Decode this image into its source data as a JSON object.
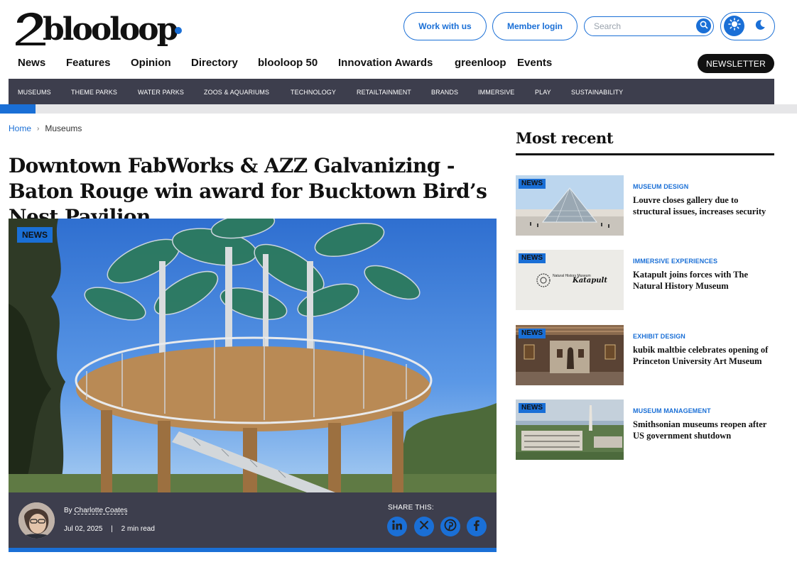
{
  "brand": {
    "logo_text": "2blooloop.",
    "accent": "#1a6fd6",
    "dark_bar": "#3d3e4d"
  },
  "header": {
    "work_with_us": "Work with us",
    "member_login": "Member login",
    "search_placeholder": "Search",
    "icons": {
      "search": "search-icon",
      "light_mode": "sun-icon",
      "dark_mode": "moon-icon"
    }
  },
  "main_nav": [
    "News",
    "Features",
    "Opinion",
    "Directory",
    "blooloop 50",
    "Innovation Awards",
    "greenloop",
    "Events"
  ],
  "newsletter_label": "NEWSLETTER",
  "sub_nav": [
    "MUSEUMS",
    "THEME PARKS",
    "WATER PARKS",
    "ZOOS & AQUARIUMS",
    "TECHNOLOGY",
    "RETAILTAINMENT",
    "BRANDS",
    "IMMERSIVE",
    "PLAY",
    "SUSTAINABILITY"
  ],
  "reading_progress_percent": 4.5,
  "breadcrumb": {
    "home": "Home",
    "current": "Museums"
  },
  "article": {
    "title": "Downtown FabWorks & AZZ Galvanizing - Baton Rouge win award for Bucktown Bird’s Nest Pavilion",
    "tag": "NEWS",
    "by_prefix": "By",
    "author": "Charlotte Coates",
    "date": "Jul 02, 2025",
    "read_time": "2 min read",
    "share_label": "SHARE THIS:",
    "share_icons": [
      "linkedin-icon",
      "x-icon",
      "pinterest-icon",
      "facebook-icon"
    ]
  },
  "sidebar": {
    "title": "Most recent",
    "items": [
      {
        "tag": "NEWS",
        "category": "MUSEUM DESIGN",
        "title": "Louvre closes gallery due to structural issues, increases security"
      },
      {
        "tag": "NEWS",
        "category": "IMMERSIVE EXPERIENCES",
        "title": "Katapult joins forces with The Natural History Museum"
      },
      {
        "tag": "NEWS",
        "category": "EXHIBIT DESIGN",
        "title": "kubik maltbie celebrates opening of Princeton University Art Museum"
      },
      {
        "tag": "NEWS",
        "category": "MUSEUM MANAGEMENT",
        "title": "Smithsonian museums reopen after US government shutdown"
      }
    ],
    "thumb_2_labels": {
      "museum": "Natural History Museum",
      "katapult": "Katapult"
    }
  }
}
